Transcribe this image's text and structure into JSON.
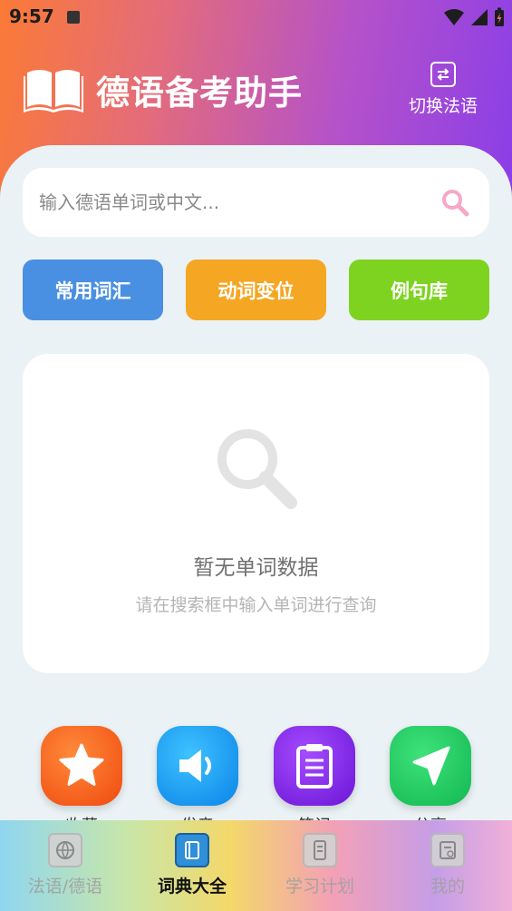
{
  "status_bar": {
    "time": "9:57"
  },
  "header": {
    "app_title": "德语备考助手",
    "switch_label": "切换法语"
  },
  "search": {
    "placeholder": "输入德语单词或中文..."
  },
  "quick_buttons": [
    {
      "label": "常用词汇",
      "color": "#4a90e2"
    },
    {
      "label": "动词变位",
      "color": "#f5a623"
    },
    {
      "label": "例句库",
      "color": "#7ed321"
    }
  ],
  "empty_state": {
    "title": "暂无单词数据",
    "subtitle": "请在搜索框中输入单词进行查询"
  },
  "actions": [
    {
      "label": "收藏",
      "icon": "star-icon"
    },
    {
      "label": "发音",
      "icon": "speaker-icon"
    },
    {
      "label": "笔记",
      "icon": "notepad-icon"
    },
    {
      "label": "分享",
      "icon": "send-icon"
    }
  ],
  "bottom_nav": [
    {
      "label": "法语/德语",
      "icon": "globe-icon",
      "active": false
    },
    {
      "label": "词典大全",
      "icon": "dictionary-icon",
      "active": true
    },
    {
      "label": "学习计划",
      "icon": "plan-icon",
      "active": false
    },
    {
      "label": "我的",
      "icon": "profile-icon",
      "active": false
    }
  ]
}
